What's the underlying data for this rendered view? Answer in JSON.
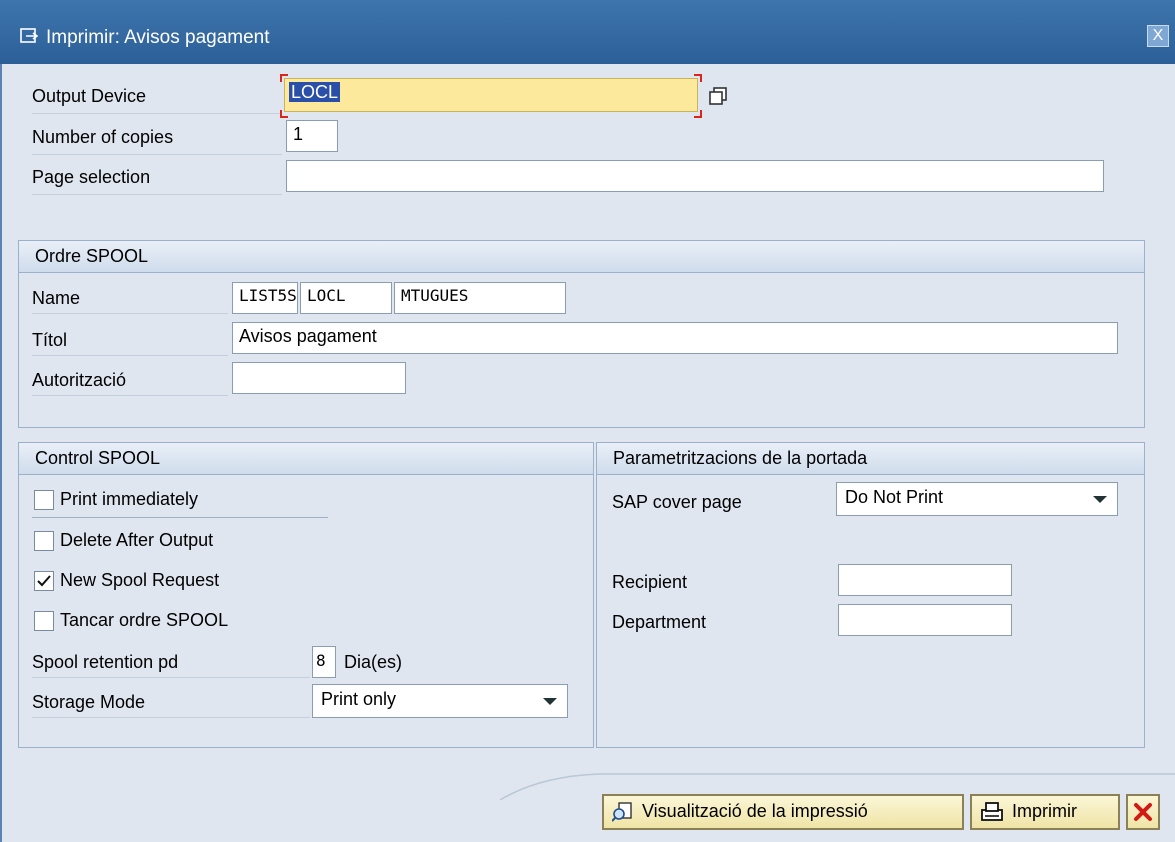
{
  "window": {
    "title": "Imprimir: Avisos pagament",
    "close_symbol": "X"
  },
  "print_form": {
    "output_device_label": "Output Device",
    "output_device_value": "LOCL",
    "copies_label": "Number of copies",
    "copies_value": "1",
    "page_selection_label": "Page selection",
    "page_selection_value": ""
  },
  "spool_order": {
    "header": "Ordre SPOOL",
    "name_label": "Name",
    "name_parts": [
      "LIST5S",
      "LOCL",
      "MTUGUES"
    ],
    "title_label": "Títol",
    "title_value": "Avisos pagament",
    "authorization_label": "Autorització",
    "authorization_value": ""
  },
  "spool_control": {
    "header": "Control SPOOL",
    "checkboxes": [
      {
        "label": "Print immediately",
        "checked": false
      },
      {
        "label": "Delete After Output",
        "checked": false
      },
      {
        "label": "New Spool Request",
        "checked": true
      },
      {
        "label": "Tancar ordre SPOOL",
        "checked": false
      }
    ],
    "retention_label": "Spool retention pd",
    "retention_value": "8",
    "retention_unit": "Dia(es)",
    "storage_label": "Storage Mode",
    "storage_value": "Print only"
  },
  "cover_page": {
    "header": "Parametritzacions de la portada",
    "sap_cover_label": "SAP cover page",
    "sap_cover_value": "Do Not Print",
    "recipient_label": "Recipient",
    "recipient_value": "",
    "department_label": "Department",
    "department_value": ""
  },
  "buttons": {
    "preview_label": "Visualització de la impressió",
    "print_label": "Imprimir"
  },
  "colors": {
    "titlebar": "#2c5f97",
    "focused_field": "#fde99c",
    "button_face": "#f5edbe",
    "cancel_red": "#d11a14"
  },
  "icons": [
    "print-dialog-icon",
    "close-icon",
    "copy-icon",
    "print-preview-icon",
    "printer-icon",
    "cancel-icon",
    "checkmark-icon",
    "dropdown-arrow-icon"
  ]
}
